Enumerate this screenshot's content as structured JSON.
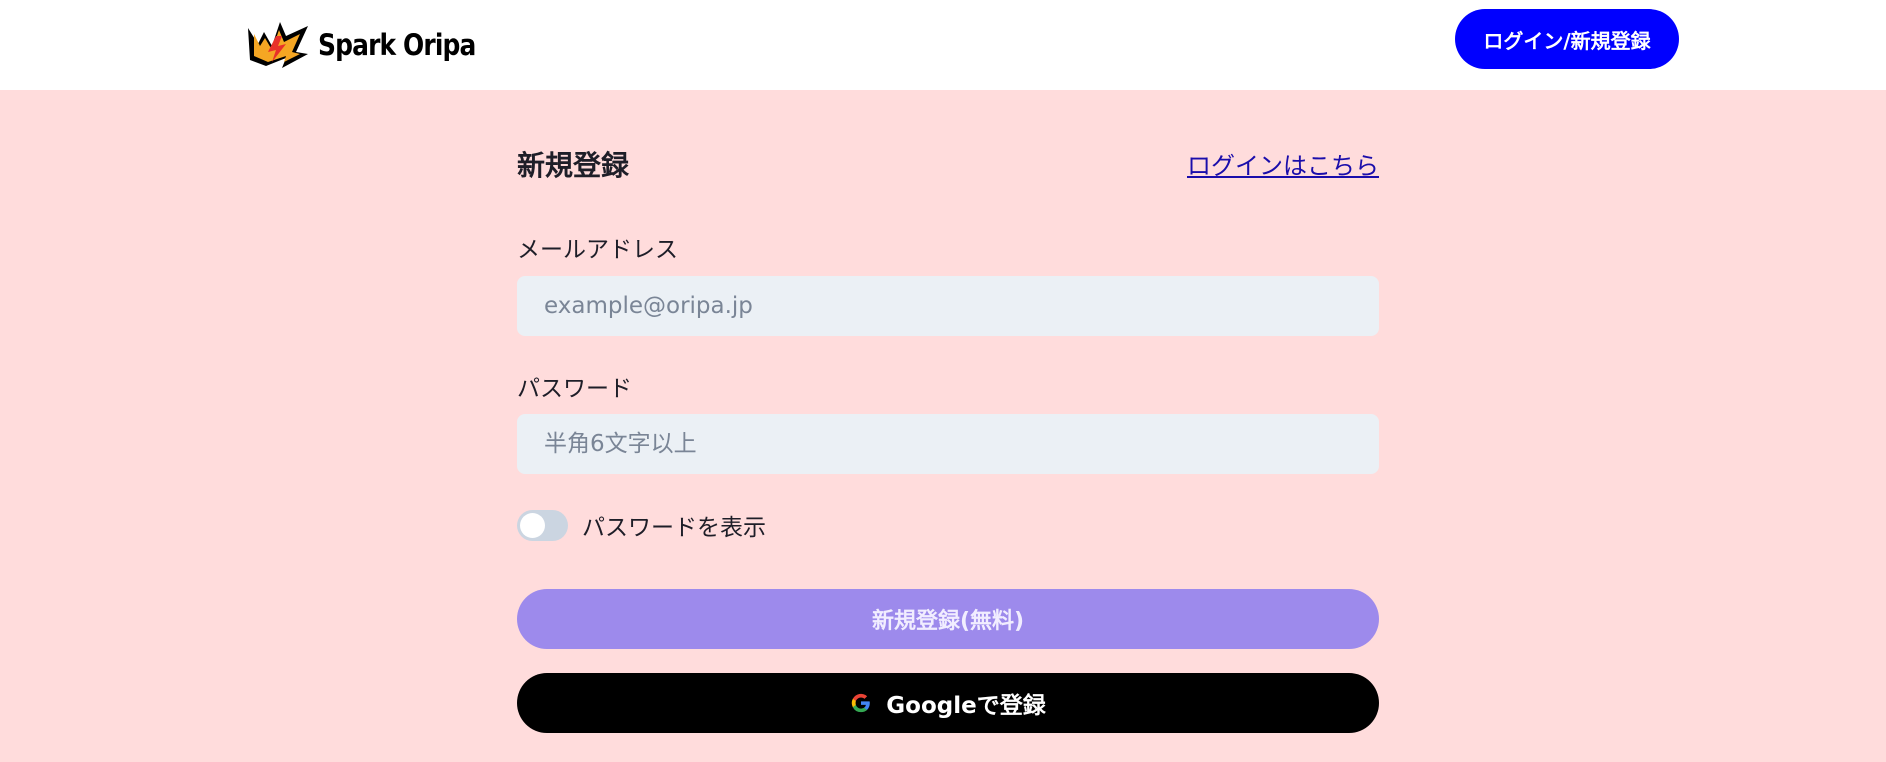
{
  "header": {
    "logo_text": "Spark Oripa",
    "login_register_label": "ログイン/新規登録"
  },
  "form": {
    "title": "新規登録",
    "login_link": "ログインはこちら",
    "email_label": "メールアドレス",
    "email_placeholder": "example@oripa.jp",
    "email_value": "",
    "password_label": "パスワード",
    "password_placeholder": "半角6文字以上",
    "password_value": "",
    "show_password_label": "パスワードを表示",
    "show_password_on": false,
    "register_button": "新規登録(無料)",
    "google_button": "Googleで登録",
    "google_icon": "google-g-icon"
  },
  "colors": {
    "page_bg": "#ffdcdc",
    "header_button": "#0000ff",
    "register_button": "#9d8aec",
    "google_button": "#000000",
    "input_bg": "#ebf0f5"
  }
}
